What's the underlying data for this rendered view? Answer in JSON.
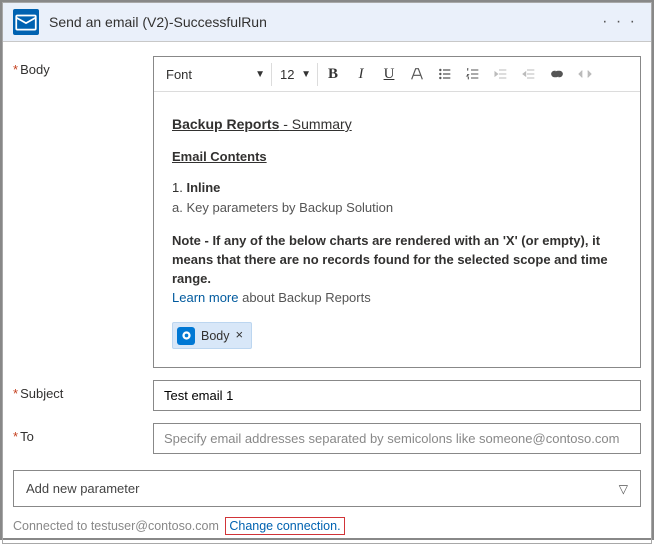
{
  "header": {
    "title": "Send an email (V2)-SuccessfulRun",
    "app_icon_glyph": "📧",
    "more_glyph": "· · ·"
  },
  "labels": {
    "body": "Body",
    "subject": "Subject",
    "to": "To",
    "required_marker": "*"
  },
  "toolbar": {
    "font_label": "Font",
    "size_label": "12"
  },
  "body_content": {
    "title_line": "Backup Reports - Summary",
    "title_prefix": "Backup Reports",
    "title_suffix": " - Summary",
    "section_heading": "Email Contents",
    "item1_num": "1. ",
    "item1_text": "Inline",
    "item1a": "a. Key parameters by Backup Solution",
    "note_label": "Note",
    "note_text": " - If any of the below charts are rendered with an 'X' (or empty), it means that there are no records found for the selected scope and time range.",
    "learn_link": "Learn more",
    "learn_text": " about Backup Reports",
    "chip_label": "Body",
    "chip_x": "×"
  },
  "fields": {
    "subject_value": "Test email 1",
    "to_placeholder": "Specify email addresses separated by semicolons like someone@contoso.com"
  },
  "add_param": {
    "label": "Add new parameter"
  },
  "footer": {
    "connected_text": "Connected to testuser@contoso.com",
    "change_link": "Change connection."
  }
}
